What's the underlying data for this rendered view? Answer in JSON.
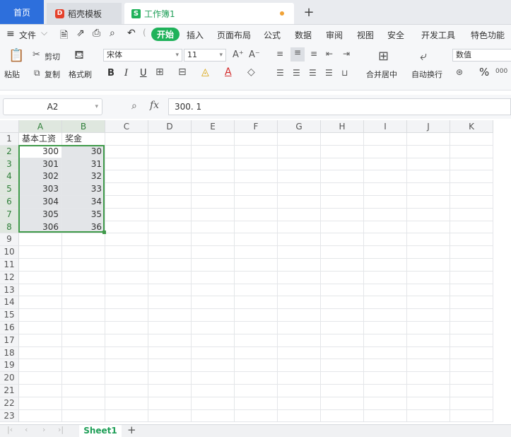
{
  "tabs": {
    "home": "首页",
    "template": "稻壳模板",
    "template_logo": "D",
    "workbook": "工作簿1",
    "workbook_logo": "S",
    "new_tab": "+"
  },
  "menu": {
    "file": "文件",
    "start": "开始",
    "items": [
      "插入",
      "页面布局",
      "公式",
      "数据",
      "审阅",
      "视图",
      "安全",
      "开发工具",
      "特色功能"
    ]
  },
  "ribbon": {
    "paste": "粘贴",
    "cut": "剪切",
    "copy": "复制",
    "format_painter": "格式刷",
    "font_name": "宋体",
    "font_size": "11",
    "bold": "B",
    "italic": "I",
    "underline": "U",
    "merge_center": "合并居中",
    "wrap_text": "自动换行",
    "number_format": "数值",
    "percent": "%"
  },
  "formula_bar": {
    "name_box": "A2",
    "fx": "fx",
    "value": "300. 1"
  },
  "grid": {
    "columns": [
      "A",
      "B",
      "C",
      "D",
      "E",
      "F",
      "G",
      "H",
      "I",
      "J",
      "K"
    ],
    "rows": [
      "1",
      "2",
      "3",
      "4",
      "5",
      "6",
      "7",
      "8",
      "9",
      "10",
      "11",
      "12",
      "13",
      "14",
      "15",
      "16",
      "17",
      "18",
      "19",
      "20",
      "21",
      "22",
      "23"
    ],
    "header_row": [
      "基本工资",
      "奖金"
    ],
    "data": [
      [
        "300",
        "30"
      ],
      [
        "301",
        "31"
      ],
      [
        "302",
        "32"
      ],
      [
        "303",
        "33"
      ],
      [
        "304",
        "34"
      ],
      [
        "305",
        "35"
      ],
      [
        "306",
        "36"
      ]
    ]
  },
  "sheets": {
    "active": "Sheet1",
    "add": "+"
  },
  "colors": {
    "accent_green": "#1fb25a",
    "selection_border": "#3f9a4a",
    "home_tab": "#2d6fdc"
  }
}
